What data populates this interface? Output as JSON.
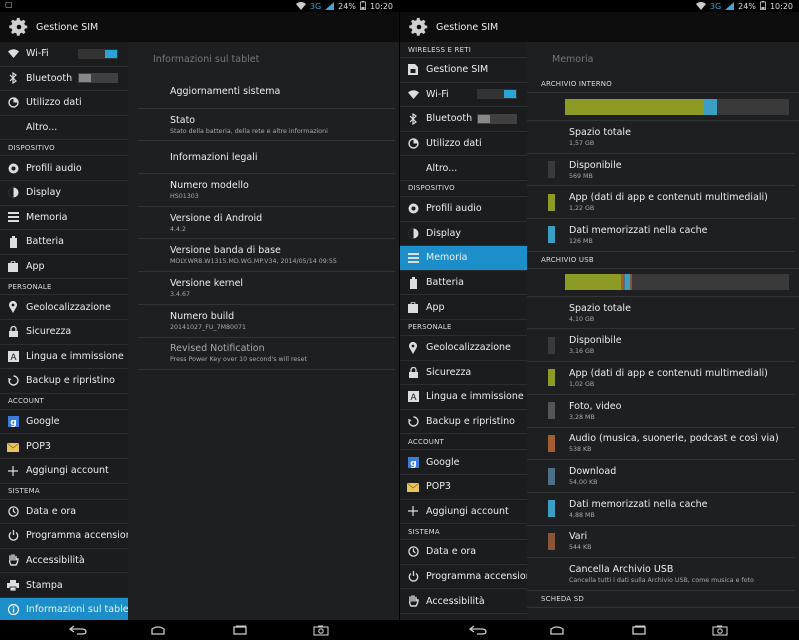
{
  "status": {
    "network": "3G",
    "battery": "24%",
    "time": "10:20"
  },
  "left": {
    "app_title": "Gestione SIM",
    "sidebar": [
      {
        "type": "item",
        "name": "wifi",
        "icon": "wifi-icon",
        "label": "Wi-Fi",
        "toggle": "on"
      },
      {
        "type": "item",
        "name": "bluetooth",
        "icon": "bluetooth-icon",
        "label": "Bluetooth",
        "toggle": "off"
      },
      {
        "type": "item",
        "name": "data-usage",
        "icon": "data-usage-icon",
        "label": "Utilizzo dati"
      },
      {
        "type": "item",
        "name": "more",
        "label": "Altro..."
      },
      {
        "type": "header",
        "label": "DISPOSITIVO"
      },
      {
        "type": "item",
        "name": "audio-profiles",
        "icon": "audio-profile-icon",
        "label": "Profili audio"
      },
      {
        "type": "item",
        "name": "display",
        "icon": "display-icon",
        "label": "Display"
      },
      {
        "type": "item",
        "name": "storage",
        "icon": "storage-icon",
        "label": "Memoria"
      },
      {
        "type": "item",
        "name": "battery",
        "icon": "battery-icon",
        "label": "Batteria"
      },
      {
        "type": "item",
        "name": "apps",
        "icon": "apps-icon",
        "label": "App"
      },
      {
        "type": "header",
        "label": "PERSONALE"
      },
      {
        "type": "item",
        "name": "location",
        "icon": "location-icon",
        "label": "Geolocalizzazione"
      },
      {
        "type": "item",
        "name": "security",
        "icon": "lock-icon",
        "label": "Sicurezza"
      },
      {
        "type": "item",
        "name": "language",
        "icon": "language-icon",
        "label": "Lingua e immissione"
      },
      {
        "type": "item",
        "name": "backup",
        "icon": "backup-icon",
        "label": "Backup e ripristino"
      },
      {
        "type": "header",
        "label": "ACCOUNT"
      },
      {
        "type": "item",
        "name": "google",
        "icon": "google-icon",
        "label": "Google"
      },
      {
        "type": "item",
        "name": "pop3",
        "icon": "email-icon",
        "label": "POP3"
      },
      {
        "type": "item",
        "name": "add-account",
        "icon": "plus-icon",
        "label": "Aggiungi account"
      },
      {
        "type": "header",
        "label": "SISTEMA"
      },
      {
        "type": "item",
        "name": "date-time",
        "icon": "clock-icon",
        "label": "Data e ora"
      },
      {
        "type": "item",
        "name": "scheduled-power",
        "icon": "power-icon",
        "label": "Programma accensione"
      },
      {
        "type": "item",
        "name": "accessibility",
        "icon": "hand-icon",
        "label": "Accessibilità"
      },
      {
        "type": "item",
        "name": "printing",
        "icon": "print-icon",
        "label": "Stampa"
      },
      {
        "type": "item",
        "name": "about-tablet",
        "icon": "info-icon",
        "label": "Informazioni sul tablet",
        "active": true
      }
    ],
    "detail_title": "Informazioni sul tablet",
    "info_items": [
      {
        "title": "Aggiornamenti sistema",
        "subtitle": ""
      },
      {
        "title": "Stato",
        "subtitle": "Stato della batteria, della rete e altre informazioni"
      },
      {
        "title": "Informazioni legali",
        "subtitle": ""
      },
      {
        "title": "Numero modello",
        "subtitle": "HS01303"
      },
      {
        "title": "Versione di Android",
        "subtitle": "4.4.2"
      },
      {
        "title": "Versione banda di base",
        "subtitle": "MOLY.WR8.W1315.MD.WG.MP.V34, 2014/05/14 09:55"
      },
      {
        "title": "Versione kernel",
        "subtitle": "3.4.67"
      },
      {
        "title": "Numero build",
        "subtitle": "20141027_FU_7M80071"
      },
      {
        "title": "Revised Notification",
        "subtitle": "Press Power Key over 10 second's will reset",
        "dim": true
      }
    ]
  },
  "right": {
    "app_title": "Gestione SIM",
    "sidebar": [
      {
        "type": "header",
        "label": "WIRELESS E RETI"
      },
      {
        "type": "item",
        "name": "sim-manager",
        "icon": "sim-icon",
        "label": "Gestione SIM"
      },
      {
        "type": "item",
        "name": "wifi",
        "icon": "wifi-icon",
        "label": "Wi-Fi",
        "toggle": "on"
      },
      {
        "type": "item",
        "name": "bluetooth",
        "icon": "bluetooth-icon",
        "label": "Bluetooth",
        "toggle": "off"
      },
      {
        "type": "item",
        "name": "data-usage",
        "icon": "data-usage-icon",
        "label": "Utilizzo dati"
      },
      {
        "type": "item",
        "name": "more",
        "label": "Altro..."
      },
      {
        "type": "header",
        "label": "DISPOSITIVO"
      },
      {
        "type": "item",
        "name": "audio-profiles",
        "icon": "audio-profile-icon",
        "label": "Profili audio"
      },
      {
        "type": "item",
        "name": "display",
        "icon": "display-icon",
        "label": "Display"
      },
      {
        "type": "item",
        "name": "storage",
        "icon": "storage-icon",
        "label": "Memoria",
        "active": true
      },
      {
        "type": "item",
        "name": "battery",
        "icon": "battery-icon",
        "label": "Batteria"
      },
      {
        "type": "item",
        "name": "apps",
        "icon": "apps-icon",
        "label": "App"
      },
      {
        "type": "header",
        "label": "PERSONALE"
      },
      {
        "type": "item",
        "name": "location",
        "icon": "location-icon",
        "label": "Geolocalizzazione"
      },
      {
        "type": "item",
        "name": "security",
        "icon": "lock-icon",
        "label": "Sicurezza"
      },
      {
        "type": "item",
        "name": "language",
        "icon": "language-icon",
        "label": "Lingua e immissione"
      },
      {
        "type": "item",
        "name": "backup",
        "icon": "backup-icon",
        "label": "Backup e ripristino"
      },
      {
        "type": "header",
        "label": "ACCOUNT"
      },
      {
        "type": "item",
        "name": "google",
        "icon": "google-icon",
        "label": "Google"
      },
      {
        "type": "item",
        "name": "pop3",
        "icon": "email-icon",
        "label": "POP3"
      },
      {
        "type": "item",
        "name": "add-account",
        "icon": "plus-icon",
        "label": "Aggiungi account"
      },
      {
        "type": "header",
        "label": "SISTEMA"
      },
      {
        "type": "item",
        "name": "date-time",
        "icon": "clock-icon",
        "label": "Data e ora"
      },
      {
        "type": "item",
        "name": "scheduled-power",
        "icon": "power-icon",
        "label": "Programma accensione"
      },
      {
        "type": "item",
        "name": "accessibility",
        "icon": "hand-icon",
        "label": "Accessibilità"
      }
    ],
    "detail_title": "Memoria",
    "sections": [
      {
        "header": "ARCHIVIO INTERNO",
        "bar": [
          {
            "fraction": 0.62,
            "color": "#8d9a24"
          },
          {
            "fraction": 0.06,
            "color": "#3a9fc2"
          },
          {
            "fraction": 0.32,
            "color": "#3a3a3a"
          }
        ],
        "items": [
          {
            "title": "Spazio totale",
            "subtitle": "1,57 GB",
            "color": ""
          },
          {
            "title": "Disponibile",
            "subtitle": "569 MB",
            "color": "#3a3a3a"
          },
          {
            "title": "App (dati di app e contenuti multimediali)",
            "subtitle": "1,22 GB",
            "color": "#8d9a24"
          },
          {
            "title": "Dati memorizzati nella cache",
            "subtitle": "126 MB",
            "color": "#3a9fc2"
          }
        ]
      },
      {
        "header": "ARCHIVIO USB",
        "bar": [
          {
            "fraction": 0.25,
            "color": "#8d9a24"
          },
          {
            "fraction": 0.01,
            "color": "#a35d2f"
          },
          {
            "fraction": 0.01,
            "color": "#4e6f86"
          },
          {
            "fraction": 0.02,
            "color": "#3a9fc2"
          },
          {
            "fraction": 0.01,
            "color": "#8a5535"
          },
          {
            "fraction": 0.7,
            "color": "#3a3a3a"
          }
        ],
        "items": [
          {
            "title": "Spazio totale",
            "subtitle": "4,10 GB",
            "color": ""
          },
          {
            "title": "Disponibile",
            "subtitle": "3,16 GB",
            "color": "#3a3a3a"
          },
          {
            "title": "App (dati di app e contenuti multimediali)",
            "subtitle": "1,02 GB",
            "color": "#8d9a24"
          },
          {
            "title": "Foto, video",
            "subtitle": "3,28 MB",
            "color": "#555"
          },
          {
            "title": "Audio (musica, suonerie, podcast e così via)",
            "subtitle": "538 KB",
            "color": "#a35d2f"
          },
          {
            "title": "Download",
            "subtitle": "54,00 KB",
            "color": "#4e6f86"
          },
          {
            "title": "Dati memorizzati nella cache",
            "subtitle": "4,88 MB",
            "color": "#3a9fc2"
          },
          {
            "title": "Vari",
            "subtitle": "544 KB",
            "color": "#8a5535"
          },
          {
            "title": "Cancella Archivio USB",
            "subtitle": "Cancella tutti i dati sulla Archivio USB, come musica e foto",
            "color": ""
          }
        ]
      },
      {
        "header": "SCHEDA SD",
        "bar": null,
        "items": []
      }
    ]
  }
}
